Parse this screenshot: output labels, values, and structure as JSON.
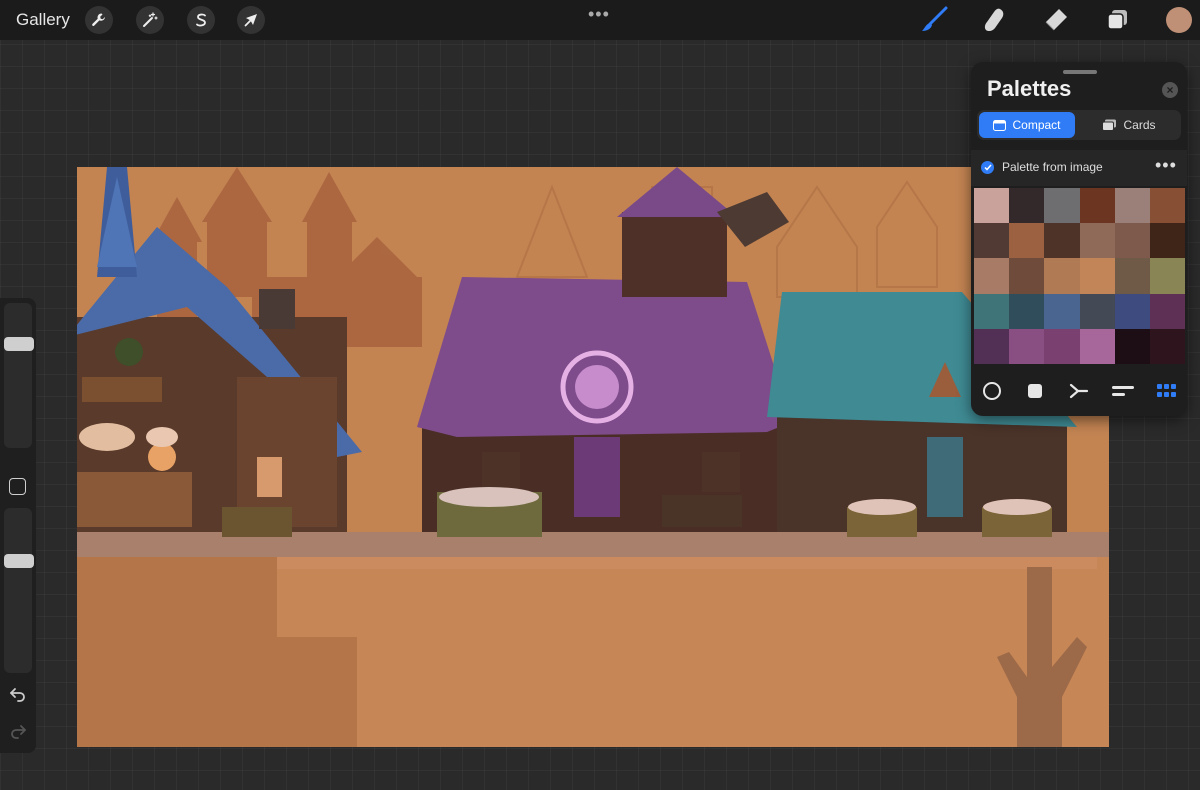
{
  "topbar": {
    "gallery_label": "Gallery",
    "left_tools": [
      {
        "name": "actions",
        "icon": "wrench-icon"
      },
      {
        "name": "adjustments",
        "icon": "magic-wand-icon"
      },
      {
        "name": "selection",
        "icon": "selection-s-icon"
      },
      {
        "name": "transform",
        "icon": "arrow-cursor-icon"
      }
    ],
    "more": "•••",
    "right_tools": [
      {
        "name": "brush",
        "icon": "brush-icon",
        "active": true
      },
      {
        "name": "smudge",
        "icon": "smudge-finger-icon"
      },
      {
        "name": "eraser",
        "icon": "eraser-icon"
      },
      {
        "name": "layers",
        "icon": "layers-icon"
      }
    ],
    "color_swatch": "#c09076",
    "accent": "#2f7cf6"
  },
  "sidebar": {
    "size_slider_level": 0.28,
    "opacity_slider_level": 0.68,
    "undo_icon": "undo-arrow-icon",
    "redo_icon": "redo-arrow-icon"
  },
  "palettes": {
    "title": "Palettes",
    "close_icon": "close-x-icon",
    "views": [
      {
        "label": "Compact",
        "active": true,
        "icon": "compact-icon"
      },
      {
        "label": "Cards",
        "active": false,
        "icon": "cards-icon"
      }
    ],
    "palette_name": "Palette from image",
    "palette_default": true,
    "swatches": [
      "#c9a39b",
      "#33292a",
      "#6e6e70",
      "#6b3522",
      "#9a8079",
      "#874f33",
      "#503a33",
      "#9c6140",
      "#4e3328",
      "#8f6a58",
      "#7d5a4b",
      "#3f2518",
      "#a87b66",
      "#6e4b3b",
      "#b07a55",
      "#c18557",
      "#6f5a47",
      "#8a8554",
      "#3f7479",
      "#2f4d5a",
      "#4b6591",
      "#444a55",
      "#3d4b7f",
      "#5e3055",
      "#522f54",
      "#8a4f82",
      "#7a4170",
      "#a8679b",
      "#1d0d14",
      "#2d141d"
    ],
    "tools": [
      "color-disc-icon",
      "color-square-icon",
      "harmony-icon",
      "value-sliders-icon",
      "palettes-grid-icon"
    ]
  }
}
